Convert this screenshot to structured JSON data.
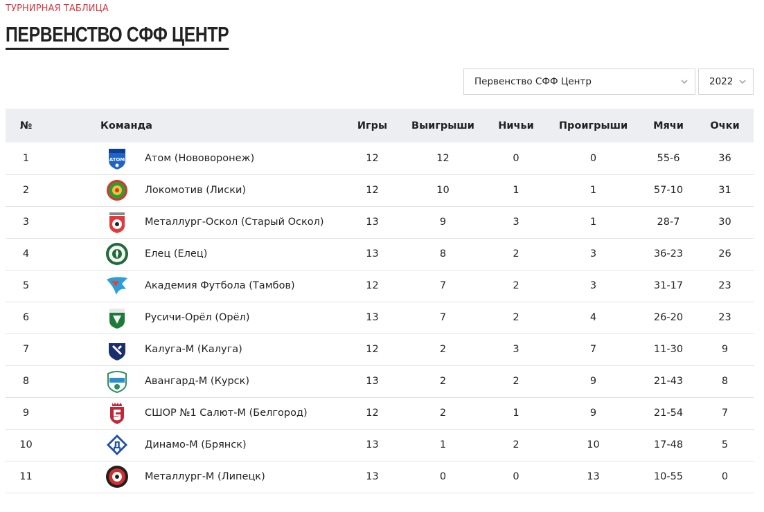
{
  "header": {
    "kicker": "ТУРНИРНАЯ ТАБЛИЦА",
    "title": "ПЕРВЕНСТВО СФФ ЦЕНТР"
  },
  "filters": {
    "competition": "Первенство СФФ Центр",
    "year": "2022"
  },
  "colors": {
    "accent": "#d9363e",
    "header_bg": "#eceef2",
    "row_border": "#e2e2e2"
  },
  "table": {
    "columns": {
      "pos": "№",
      "team": "Команда",
      "games": "Игры",
      "wins": "Выигрыши",
      "draws": "Ничьи",
      "losses": "Проигрыши",
      "goals": "Мячи",
      "points": "Очки"
    },
    "rows": [
      {
        "pos": "1",
        "team": "Атом (Нововоронеж)",
        "games": "12",
        "wins": "12",
        "draws": "0",
        "losses": "0",
        "goals": "55-6",
        "points": "36",
        "logo": "atom-logo-icon"
      },
      {
        "pos": "2",
        "team": "Локомотив (Лиски)",
        "games": "12",
        "wins": "10",
        "draws": "1",
        "losses": "1",
        "goals": "57-10",
        "points": "31",
        "logo": "lokomotiv-logo-icon"
      },
      {
        "pos": "3",
        "team": "Металлург-Оскол (Старый Оскол)",
        "games": "13",
        "wins": "9",
        "draws": "3",
        "losses": "1",
        "goals": "28-7",
        "points": "30",
        "logo": "metallurg-oskol-logo-icon"
      },
      {
        "pos": "4",
        "team": "Елец (Елец)",
        "games": "13",
        "wins": "8",
        "draws": "2",
        "losses": "3",
        "goals": "36-23",
        "points": "26",
        "logo": "elets-logo-icon"
      },
      {
        "pos": "5",
        "team": "Академия Футбола (Тамбов)",
        "games": "12",
        "wins": "7",
        "draws": "2",
        "losses": "3",
        "goals": "31-17",
        "points": "23",
        "logo": "akademiya-logo-icon"
      },
      {
        "pos": "6",
        "team": "Русичи-Орёл (Орёл)",
        "games": "13",
        "wins": "7",
        "draws": "2",
        "losses": "4",
        "goals": "26-20",
        "points": "23",
        "logo": "rusichi-logo-icon"
      },
      {
        "pos": "7",
        "team": "Калуга-М (Калуга)",
        "games": "12",
        "wins": "2",
        "draws": "3",
        "losses": "7",
        "goals": "11-30",
        "points": "9",
        "logo": "kaluga-logo-icon"
      },
      {
        "pos": "8",
        "team": "Авангард-М (Курск)",
        "games": "13",
        "wins": "2",
        "draws": "2",
        "losses": "9",
        "goals": "21-43",
        "points": "8",
        "logo": "avangard-logo-icon"
      },
      {
        "pos": "9",
        "team": "СШОР №1 Салют-М (Белгород)",
        "games": "12",
        "wins": "2",
        "draws": "1",
        "losses": "9",
        "goals": "21-54",
        "points": "7",
        "logo": "salyut-logo-icon"
      },
      {
        "pos": "10",
        "team": "Динамо-М (Брянск)",
        "games": "13",
        "wins": "1",
        "draws": "2",
        "losses": "10",
        "goals": "17-48",
        "points": "5",
        "logo": "dinamo-logo-icon"
      },
      {
        "pos": "11",
        "team": "Металлург-М (Липецк)",
        "games": "13",
        "wins": "0",
        "draws": "0",
        "losses": "13",
        "goals": "10-55",
        "points": "0",
        "logo": "metallurg-lipetsk-logo-icon"
      }
    ]
  }
}
